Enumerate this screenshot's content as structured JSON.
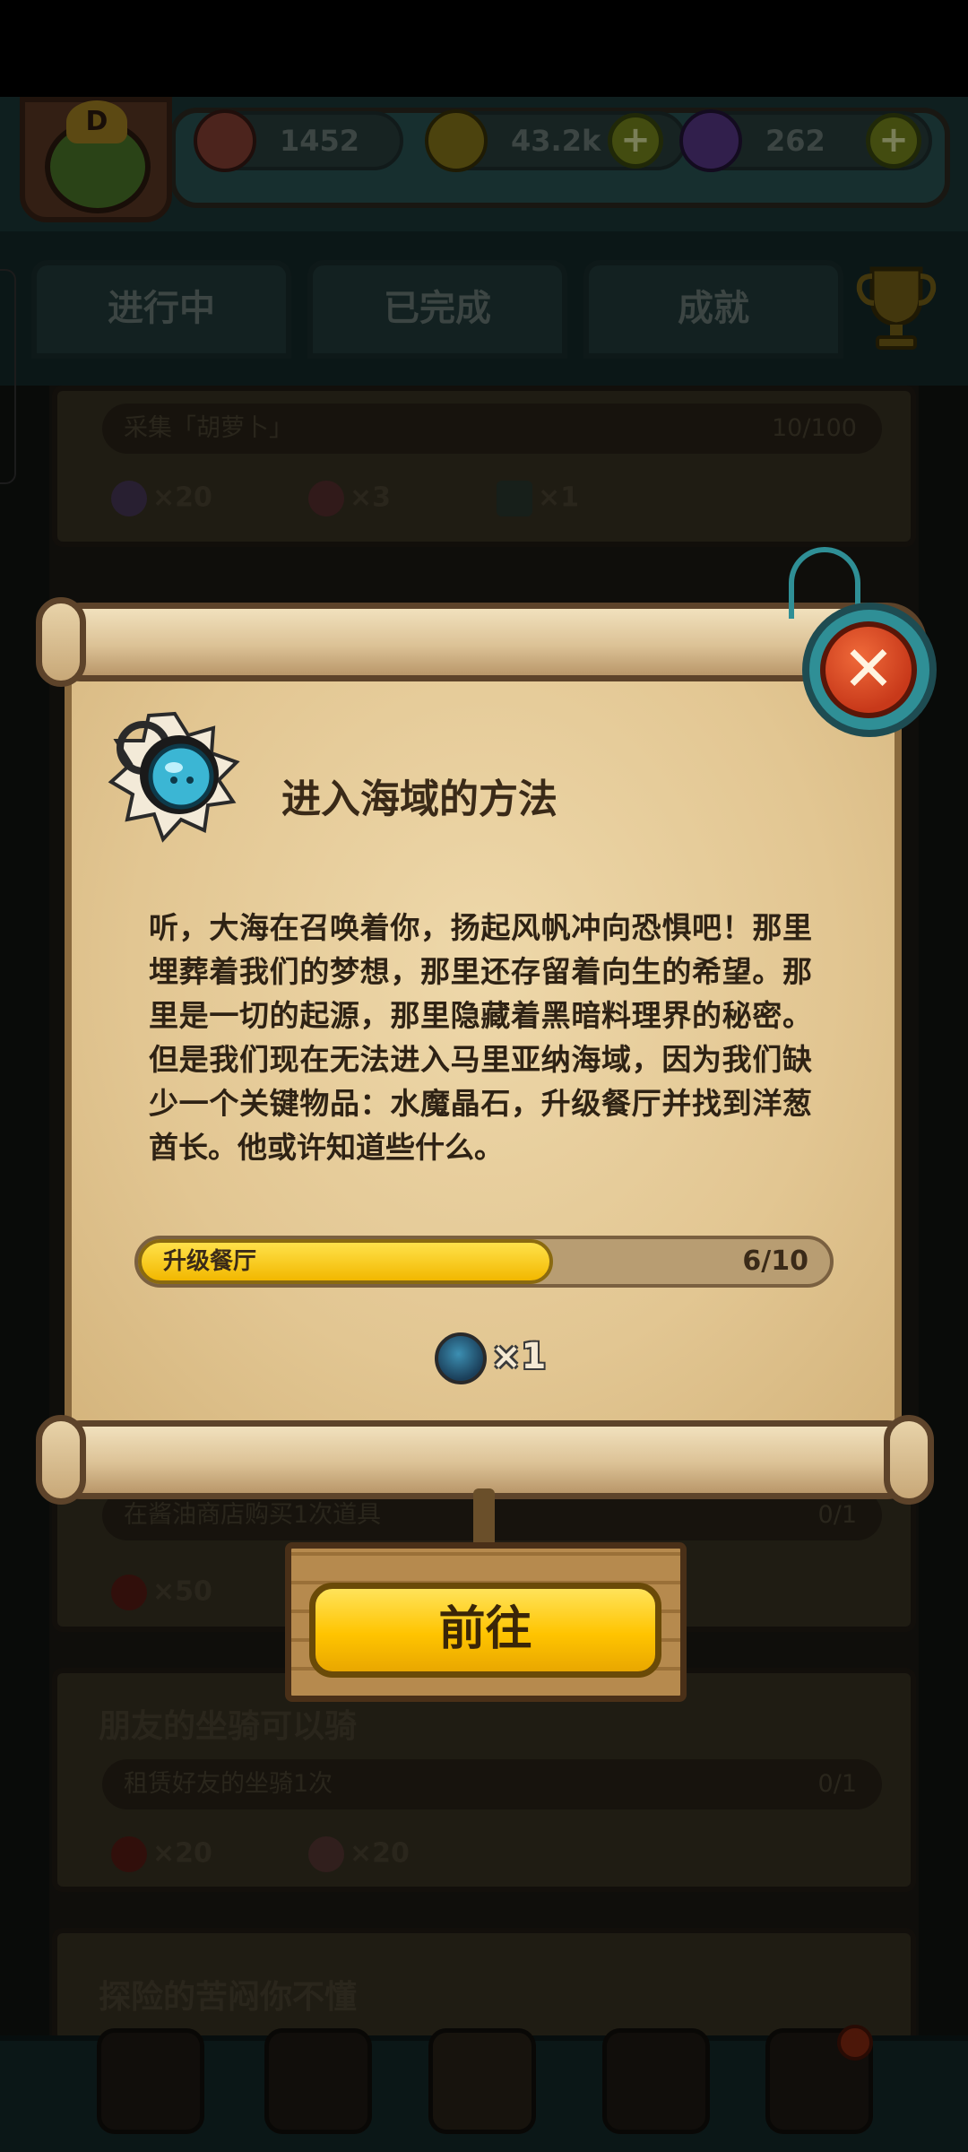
{
  "header": {
    "level_badge": "D",
    "resources": [
      {
        "name": "eyeball",
        "value": "1452",
        "color": "#8a4236"
      },
      {
        "name": "coin",
        "value": "43.2k",
        "color": "#8a7a1a"
      },
      {
        "name": "potion",
        "value": "262",
        "color": "#5a3a8a"
      }
    ]
  },
  "tabs": [
    "进行中",
    "已完成",
    "成就"
  ],
  "background_quests": [
    {
      "title": "",
      "task": "采集「胡萝卜」",
      "progress": "10/100",
      "rewards": [
        "×20",
        "×3",
        "×1"
      ]
    },
    {
      "title": "",
      "task": "在酱油商店购买1次道具",
      "progress": "0/1",
      "rewards": [
        "×50"
      ]
    },
    {
      "title": "朋友的坐骑可以骑",
      "task": "租赁好友的坐骑1次",
      "progress": "0/1",
      "rewards": [
        "×20",
        "×20"
      ]
    },
    {
      "title": "探险的苦闷你不懂",
      "task": "",
      "progress": "",
      "rewards": []
    }
  ],
  "dialog": {
    "title": "进入海域的方法",
    "description": "听，大海在召唤着你，扬起风帆冲向恐惧吧！那里埋葬着我们的梦想，那里还存留着向生的希望。那里是一切的起源，那里隐藏着黑暗料理界的秘密。但是我们现在无法进入马里亚纳海域，因为我们缺少一个关键物品：水魔晶石，升级餐厅并找到洋葱酋长。他或许知道些什么。",
    "progress_label": "升级餐厅",
    "progress_text": "6/10",
    "progress_fraction": 0.6,
    "reward_qty": "×1",
    "go_button": "前往",
    "close_icon": "close-x-icon"
  },
  "colors": {
    "parchment": "#e6cc9c",
    "progress_yellow": "#ffd21a",
    "close_red": "#d8441f",
    "teal_frame": "#2f8f96"
  }
}
